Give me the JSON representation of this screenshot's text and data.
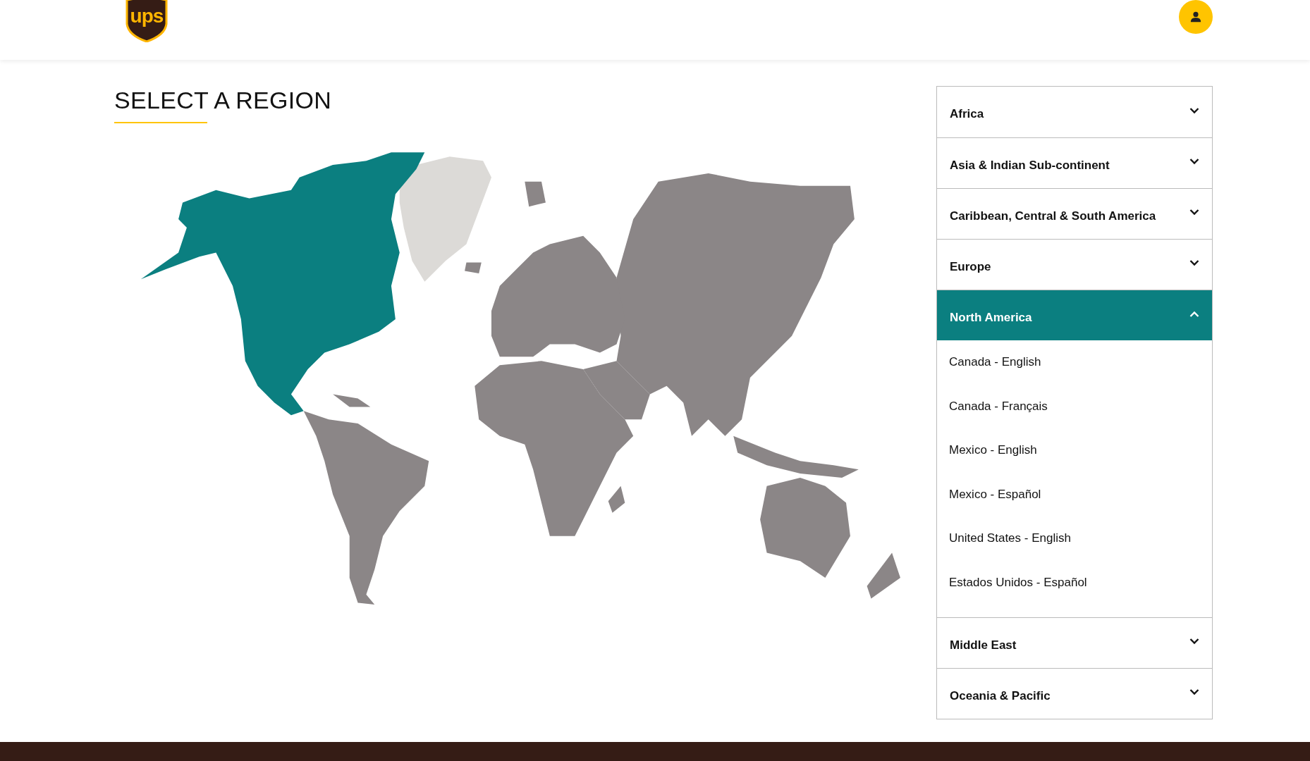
{
  "header": {
    "logo": "ups"
  },
  "title": "SELECT A REGION",
  "regions": [
    {
      "label": "Africa",
      "expanded": false
    },
    {
      "label": "Asia & Indian Sub-continent",
      "expanded": false
    },
    {
      "label": "Caribbean, Central & South America",
      "expanded": false
    },
    {
      "label": "Europe",
      "expanded": false
    },
    {
      "label": "North America",
      "expanded": true,
      "countries": [
        "Canada - English",
        "Canada - Français",
        "Mexico - English",
        "Mexico - Español",
        "United States - English",
        "Estados Unidos - Español"
      ]
    },
    {
      "label": "Middle East",
      "expanded": false
    },
    {
      "label": "Oceania & Pacific",
      "expanded": false
    }
  ]
}
